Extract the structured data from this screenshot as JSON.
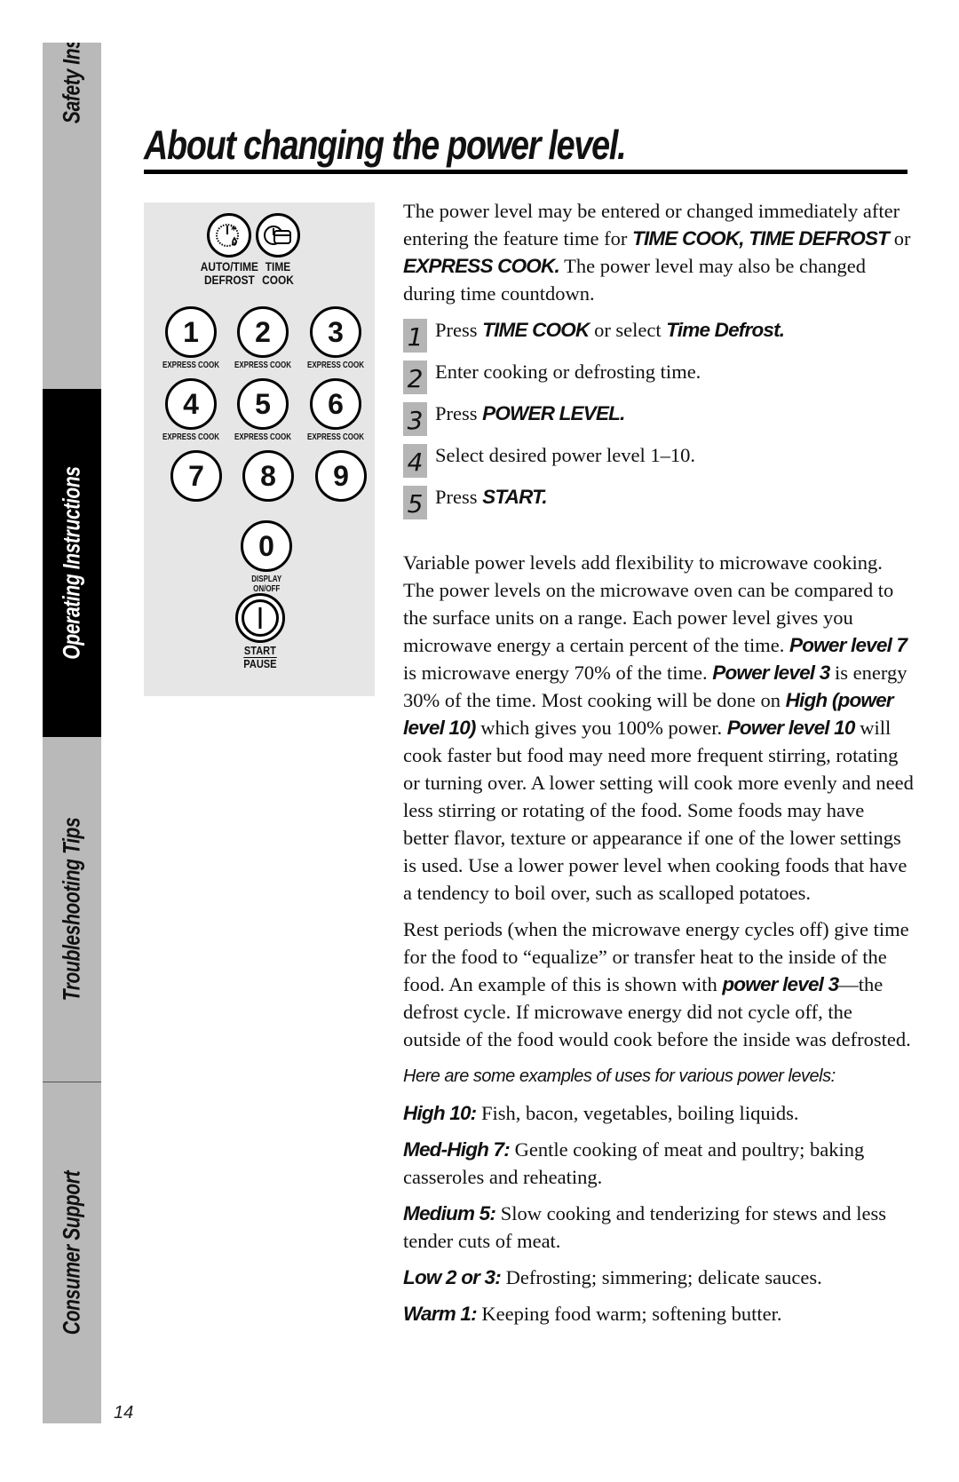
{
  "sidebar": {
    "tabs": [
      {
        "label": "Safety Instructions",
        "active": false
      },
      {
        "label": "Operating Instructions",
        "active": true
      },
      {
        "label": "Troubleshooting Tips",
        "active": false
      },
      {
        "label": "Consumer Support",
        "active": false
      }
    ],
    "page_number": "14"
  },
  "title": "About changing the power level.",
  "keypad": {
    "auto_defrost": {
      "label1": "AUTO/TIME",
      "label2": "DEFROST",
      "icon": "defrost-clock-icon"
    },
    "time_cook": {
      "label1": "TIME",
      "label2": "COOK",
      "icon": "time-cook-icon"
    },
    "digits": [
      {
        "digit": "1",
        "label": "EXPRESS COOK"
      },
      {
        "digit": "2",
        "label": "EXPRESS COOK"
      },
      {
        "digit": "3",
        "label": "EXPRESS COOK"
      },
      {
        "digit": "4",
        "label": "EXPRESS COOK"
      },
      {
        "digit": "5",
        "label": "EXPRESS COOK"
      },
      {
        "digit": "6",
        "label": "EXPRESS COOK"
      },
      {
        "digit": "7",
        "label": ""
      },
      {
        "digit": "8",
        "label": ""
      },
      {
        "digit": "9",
        "label": ""
      }
    ],
    "zero": {
      "digit": "0",
      "label1": "DISPLAY",
      "label2": "ON/OFF"
    },
    "start": {
      "label1": "START",
      "label2": "PAUSE"
    }
  },
  "intro": {
    "t1": "The power level may be entered or changed immediately after entering the feature time for ",
    "b1": "TIME COOK, TIME DEFROST",
    "t2": " or ",
    "b2": "EXPRESS COOK.",
    "t3": " The power level may also be changed during time countdown."
  },
  "steps": [
    {
      "num": "1",
      "t1": "Press ",
      "b1": "TIME COOK",
      "t2": " or select ",
      "b2": "Time Defrost."
    },
    {
      "num": "2",
      "t1": "Enter cooking or defrosting time.",
      "b1": "",
      "t2": "",
      "b2": ""
    },
    {
      "num": "3",
      "t1": "Press ",
      "b1": "POWER LEVEL.",
      "t2": "",
      "b2": ""
    },
    {
      "num": "4",
      "t1": "Select desired power level 1–10.",
      "b1": "",
      "t2": "",
      "b2": ""
    },
    {
      "num": "5",
      "t1": "Press ",
      "b1": "START.",
      "t2": "",
      "b2": ""
    }
  ],
  "variable": {
    "t1": "Variable power levels add flexibility to microwave cooking. The power levels on the microwave oven can be compared to the surface units on a range. Each power level gives you microwave energy a certain percent of the time. ",
    "b1": "Power level 7",
    "t2": " is microwave energy 70% of the time. ",
    "b2": "Power level 3",
    "t3": " is energy 30% of the time. Most cooking will be done on ",
    "b3": "High (power level 10)",
    "t4": " which gives you 100% power. ",
    "b4": "Power level 10",
    "t5": " will cook faster but food may need more frequent stirring, rotating or turning over. A lower setting will cook more evenly and need less stirring or rotating of the food. Some foods may have better flavor, texture or appearance if one of the lower settings is used. Use a lower power level when cooking foods that have a tendency to boil over, such as scalloped potatoes."
  },
  "rest": {
    "t1": "Rest periods (when the microwave energy cycles off) give time for the food to “equalize” or transfer heat to the inside of the food. An example of this is shown with ",
    "b1": "power level 3",
    "t2": "—the defrost cycle. If microwave energy did not cycle off, the outside of the food would cook before the inside was defrosted."
  },
  "examples_intro": "Here are some examples of uses for various power levels:",
  "examples": [
    {
      "level": "High 10:",
      "text": " Fish, bacon, vegetables, boiling liquids."
    },
    {
      "level": "Med-High 7:",
      "text": " Gentle cooking of meat and poultry; baking casseroles and reheating."
    },
    {
      "level": "Medium 5:",
      "text": " Slow cooking and tenderizing for stews and less tender cuts of meat."
    },
    {
      "level": "Low 2 or 3:",
      "text": " Defrosting; simmering; delicate sauces."
    },
    {
      "level": "Warm 1:",
      "text": " Keeping food warm; softening butter."
    }
  ]
}
